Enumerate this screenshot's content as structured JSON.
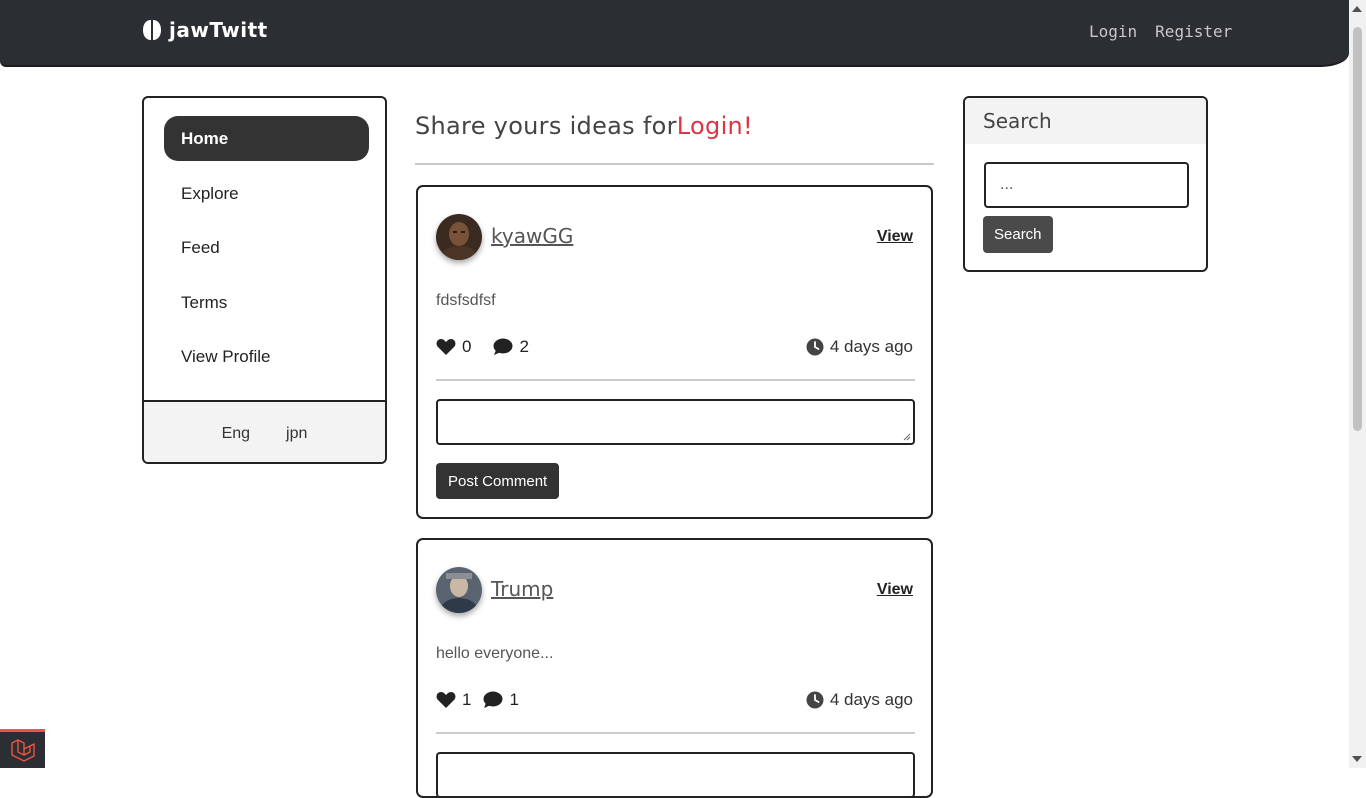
{
  "navbar": {
    "brand": "jawTwitt",
    "links": {
      "login": "Login",
      "register": "Register"
    }
  },
  "sidebar": {
    "items": [
      {
        "label": "Home",
        "active": true
      },
      {
        "label": "Explore"
      },
      {
        "label": "Feed"
      },
      {
        "label": "Terms"
      },
      {
        "label": "View Profile"
      }
    ],
    "languages": {
      "eng": "Eng",
      "jpn": "jpn"
    }
  },
  "main": {
    "heading": "Share yours ideas for",
    "heading_accent": "Login!",
    "posts": [
      {
        "username": "kyawGG",
        "view_label": "View",
        "body": "fdsfsdfsf",
        "likes": "0",
        "comments": "2",
        "time": "4 days ago",
        "post_comment_label": "Post Comment"
      },
      {
        "username": "Trump",
        "view_label": "View",
        "body": "hello everyone...",
        "likes": "1",
        "comments": "1",
        "time": "4 days ago"
      }
    ]
  },
  "search": {
    "title": "Search",
    "input_value": "...",
    "button_label": "Search"
  },
  "colors": {
    "navbar": "#2b2e32",
    "accent": "#dc3545",
    "active_item": "#333333"
  },
  "icons": [
    "brain-icon",
    "heart-icon",
    "comment-icon",
    "clock-icon",
    "laravel-icon"
  ]
}
